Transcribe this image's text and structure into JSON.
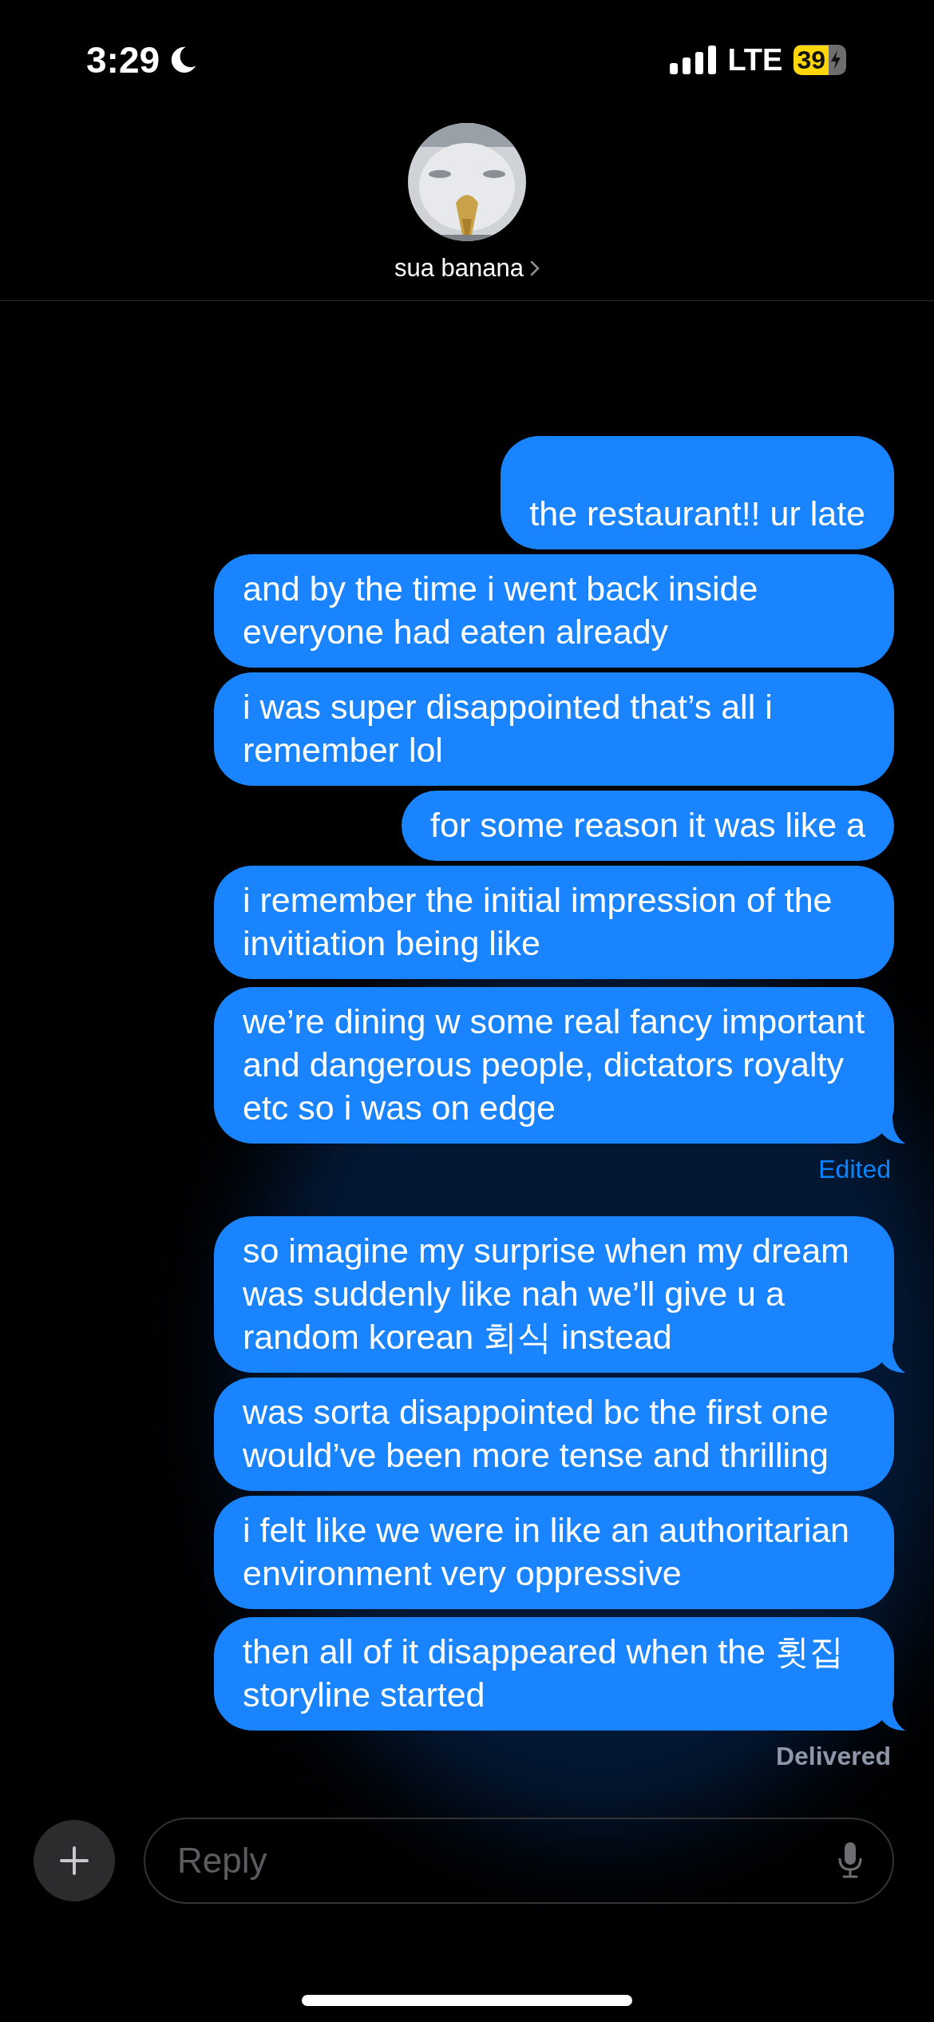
{
  "status_bar": {
    "time": "3:29",
    "network": "LTE",
    "battery": "39",
    "charging": true,
    "focus_moon": true
  },
  "header": {
    "contact_name": "sua banana"
  },
  "messages": [
    {
      "text": "the restaurant!! ur late",
      "tail": false,
      "cut_top": true
    },
    {
      "text": "and by the time i went back inside everyone had eaten already",
      "tail": false,
      "cut_top": false
    },
    {
      "text": "i was super disappointed that’s all i remember lol",
      "tail": false,
      "cut_top": false
    },
    {
      "text": "for some reason it was like a",
      "tail": false,
      "cut_top": false
    },
    {
      "text": "i remember the initial impression of the invitiation being like",
      "tail": false,
      "cut_top": false
    },
    {
      "text": "we’re dining w some real fancy important and dangerous people, dictators royalty etc so i was on edge",
      "tail": true,
      "cut_top": false,
      "note": {
        "kind": "edited",
        "text": "Edited"
      }
    },
    {
      "text": "so imagine my surprise when my dream was suddenly like nah we’ll give u a random korean 회식 instead",
      "tail": true,
      "cut_top": false
    },
    {
      "text": "was sorta disappointed bc the first one would’ve been more tense and thrilling",
      "tail": false,
      "cut_top": false
    },
    {
      "text": "i felt like we were in like an authoritarian environment very oppressive",
      "tail": false,
      "cut_top": false
    },
    {
      "text": "then all of it disappeared when the 횟집 storyline started",
      "tail": true,
      "cut_top": false,
      "note": {
        "kind": "delivered",
        "text": "Delivered"
      }
    }
  ],
  "composer": {
    "placeholder": "Reply"
  }
}
